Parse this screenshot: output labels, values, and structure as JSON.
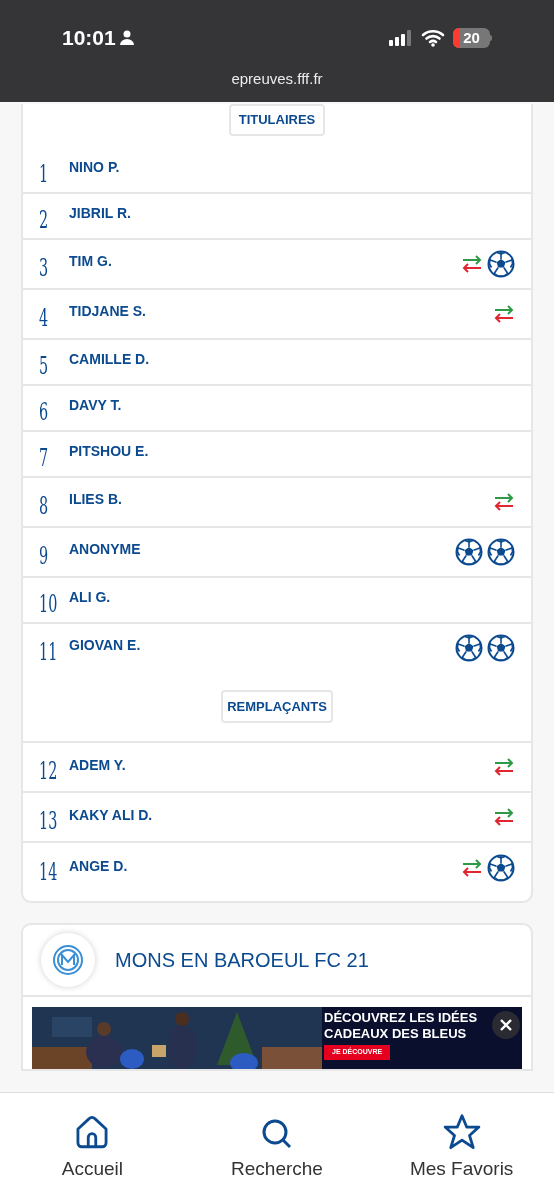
{
  "status_bar": {
    "time": "10:01",
    "battery": "20"
  },
  "url": "epreuves.fff.fr",
  "lineup": {
    "starters_label": "TITULAIRES",
    "starters": [
      {
        "number": "1",
        "name": "NINO P."
      },
      {
        "number": "2",
        "name": "JIBRIL R."
      },
      {
        "number": "3",
        "name": "TIM G.",
        "events": [
          {
            "kind": "substitution"
          },
          {
            "kind": "goal"
          }
        ]
      },
      {
        "number": "4",
        "name": "TIDJANE S.",
        "events": [
          {
            "kind": "substitution"
          }
        ]
      },
      {
        "number": "5",
        "name": "CAMILLE D."
      },
      {
        "number": "6",
        "name": "DAVY T."
      },
      {
        "number": "7",
        "name": "PITSHOU E."
      },
      {
        "number": "8",
        "name": "ILIES B.",
        "events": [
          {
            "kind": "substitution"
          }
        ]
      },
      {
        "number": "9",
        "name": "ANONYME",
        "events": [
          {
            "kind": "goal"
          },
          {
            "kind": "goal"
          }
        ]
      },
      {
        "number": "10",
        "name": "ALI G."
      },
      {
        "number": "11",
        "name": "GIOVAN E.",
        "events": [
          {
            "kind": "goal"
          },
          {
            "kind": "goal"
          }
        ]
      }
    ],
    "subs_label": "REMPLAÇANTS",
    "subs": [
      {
        "number": "12",
        "name": "ADEM Y.",
        "events": [
          {
            "kind": "substitution"
          }
        ]
      },
      {
        "number": "13",
        "name": "KAKY ALI D.",
        "events": [
          {
            "kind": "substitution"
          }
        ]
      },
      {
        "number": "14",
        "name": "ANGE D.",
        "events": [
          {
            "kind": "substitution"
          },
          {
            "kind": "goal"
          }
        ]
      }
    ]
  },
  "club": {
    "name": "MONS EN BAROEUL FC 21"
  },
  "ad": {
    "headline": "DÉCOUVREZ LES IDÉES CADEAUX DES BLEUS",
    "cta": "JE DÉCOUVRE"
  },
  "bottom_nav": [
    {
      "label": "Accueil",
      "kind": "home"
    },
    {
      "label": "Recherche",
      "kind": "search"
    },
    {
      "label": "Mes Favoris",
      "kind": "favorites"
    }
  ]
}
